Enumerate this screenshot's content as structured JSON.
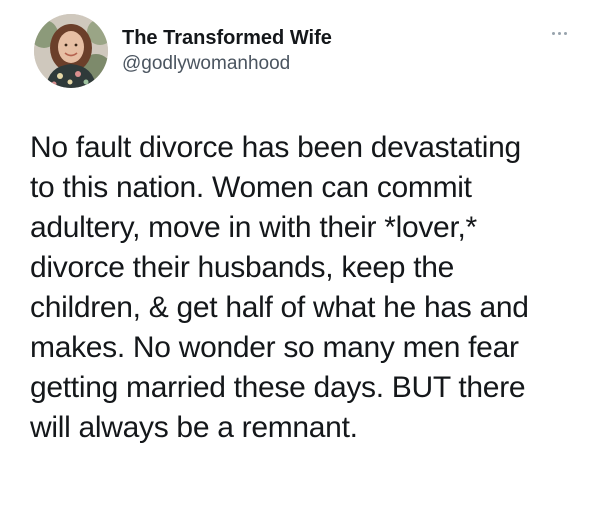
{
  "tweet": {
    "author": {
      "display_name": "The Transformed Wife",
      "handle": "@godlywomanhood",
      "avatar_icon": "profile-photo"
    },
    "more_icon": "more-options-icon",
    "text_lines": [
      "No fault divorce has been devastating",
      "to this nation. Women can commit",
      "adultery, move in with their *lover,*",
      "divorce their husbands, keep the",
      "children, & get half of what he has and",
      "makes. No wonder so many men fear",
      "getting married these days. BUT there",
      "will always be a remnant."
    ]
  },
  "colors": {
    "background": "#ffffff",
    "text": "#14171a",
    "secondary_text": "#4b5560",
    "icon": "#98a3ad"
  }
}
